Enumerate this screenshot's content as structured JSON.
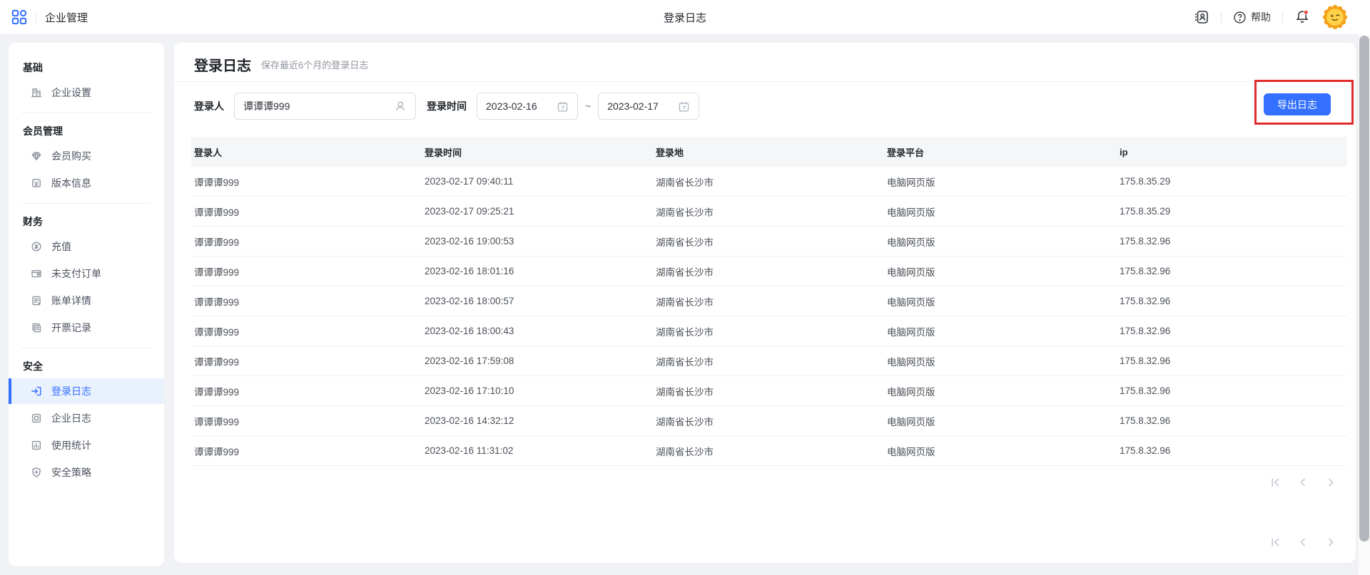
{
  "header": {
    "app_title": "企业管理",
    "center_title": "登录日志",
    "help_label": "帮助"
  },
  "sidebar": {
    "sections": [
      {
        "title": "基础",
        "items": [
          {
            "label": "企业设置",
            "icon": "building-icon",
            "active": false
          }
        ]
      },
      {
        "title": "会员管理",
        "items": [
          {
            "label": "会员购买",
            "icon": "gem-icon",
            "active": false
          },
          {
            "label": "版本信息",
            "icon": "version-info-icon",
            "active": false
          }
        ]
      },
      {
        "title": "财务",
        "items": [
          {
            "label": "充值",
            "icon": "recharge-icon",
            "active": false
          },
          {
            "label": "未支付订单",
            "icon": "wallet-icon",
            "active": false
          },
          {
            "label": "账单详情",
            "icon": "bill-detail-icon",
            "active": false
          },
          {
            "label": "开票记录",
            "icon": "invoice-record-icon",
            "active": false
          }
        ]
      },
      {
        "title": "安全",
        "items": [
          {
            "label": "登录日志",
            "icon": "login-log-icon",
            "active": true
          },
          {
            "label": "企业日志",
            "icon": "company-log-icon",
            "active": false
          },
          {
            "label": "使用统计",
            "icon": "usage-stats-icon",
            "active": false
          },
          {
            "label": "安全策略",
            "icon": "security-policy-icon",
            "active": false
          }
        ]
      }
    ]
  },
  "main": {
    "title": "登录日志",
    "subtitle": "保存最近6个月的登录日志",
    "filters": {
      "user_label": "登录人",
      "user_value": "谭谭谭999",
      "time_label": "登录时间",
      "date_from": "2023-02-16",
      "date_separator": "~",
      "date_to": "2023-02-17"
    },
    "export_button_label": "导出日志",
    "table": {
      "columns": [
        "登录人",
        "登录时间",
        "登录地",
        "登录平台",
        "ip"
      ],
      "rows": [
        [
          "谭谭谭999",
          "2023-02-17 09:40:11",
          "湖南省长沙市",
          "电脑网页版",
          "175.8.35.29"
        ],
        [
          "谭谭谭999",
          "2023-02-17 09:25:21",
          "湖南省长沙市",
          "电脑网页版",
          "175.8.35.29"
        ],
        [
          "谭谭谭999",
          "2023-02-16 19:00:53",
          "湖南省长沙市",
          "电脑网页版",
          "175.8.32.96"
        ],
        [
          "谭谭谭999",
          "2023-02-16 18:01:16",
          "湖南省长沙市",
          "电脑网页版",
          "175.8.32.96"
        ],
        [
          "谭谭谭999",
          "2023-02-16 18:00:57",
          "湖南省长沙市",
          "电脑网页版",
          "175.8.32.96"
        ],
        [
          "谭谭谭999",
          "2023-02-16 18:00:43",
          "湖南省长沙市",
          "电脑网页版",
          "175.8.32.96"
        ],
        [
          "谭谭谭999",
          "2023-02-16 17:59:08",
          "湖南省长沙市",
          "电脑网页版",
          "175.8.32.96"
        ],
        [
          "谭谭谭999",
          "2023-02-16 17:10:10",
          "湖南省长沙市",
          "电脑网页版",
          "175.8.32.96"
        ],
        [
          "谭谭谭999",
          "2023-02-16 14:32:12",
          "湖南省长沙市",
          "电脑网页版",
          "175.8.32.96"
        ],
        [
          "谭谭谭999",
          "2023-02-16 11:31:02",
          "湖南省长沙市",
          "电脑网页版",
          "175.8.32.96"
        ]
      ]
    }
  },
  "colors": {
    "accent_blue": "#3370ff",
    "annotation_red": "#e02b2b",
    "active_item_bg": "#e9f1fd"
  }
}
